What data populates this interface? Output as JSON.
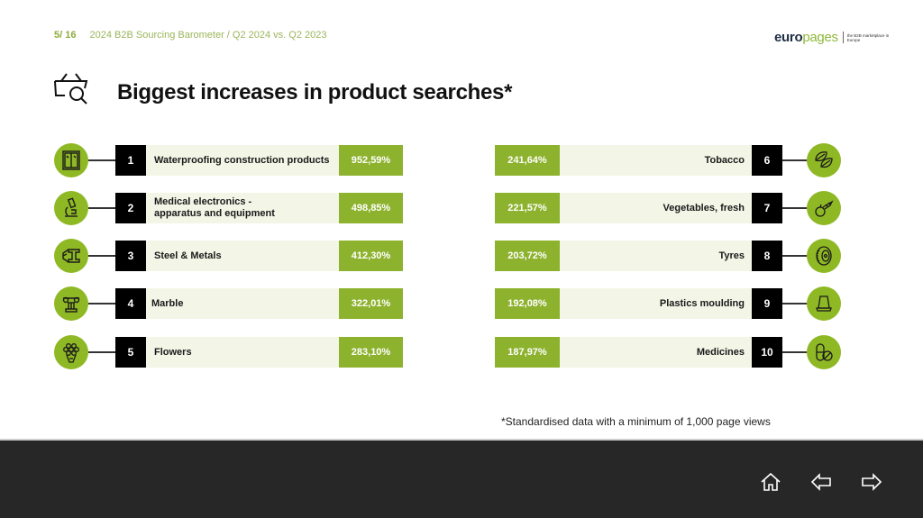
{
  "header": {
    "page_indicator": "5/ 16",
    "breadcrumb": "2024 B2B Sourcing Barometer / Q2 2024 vs. Q2 2023"
  },
  "logo": {
    "part1": "euro",
    "part2": "pages",
    "tagline": "the B2B marketplace in Europe"
  },
  "title": "Biggest increases in product searches*",
  "colors": {
    "accent_green": "#8db22e",
    "label_bg": "#f3f5e6",
    "number_bg": "#000000",
    "footer_bg": "#272727"
  },
  "left_items": [
    {
      "rank": "1",
      "label": "Waterproofing construction products",
      "value": "952,59%",
      "icon": "window-icon"
    },
    {
      "rank": "2",
      "label": "Medical electronics - apparatus and equipment",
      "label_line1": "Medical electronics -",
      "label_line2": "apparatus and equipment",
      "value": "498,85%",
      "icon": "microscope-icon"
    },
    {
      "rank": "3",
      "label": "Steel & Metals",
      "value": "412,30%",
      "icon": "steel-beam-icon"
    },
    {
      "rank": "4",
      "label": "Marble",
      "value": "322,01%",
      "icon": "column-icon"
    },
    {
      "rank": "5",
      "label": "Flowers",
      "value": "283,10%",
      "icon": "bouquet-icon"
    }
  ],
  "right_items": [
    {
      "rank": "6",
      "label": "Tobacco",
      "value": "241,64%",
      "icon": "leaves-icon"
    },
    {
      "rank": "7",
      "label": "Vegetables, fresh",
      "value": "221,57%",
      "icon": "vegetables-icon"
    },
    {
      "rank": "8",
      "label": "Tyres",
      "value": "203,72%",
      "icon": "tyre-icon"
    },
    {
      "rank": "9",
      "label": "Plastics moulding",
      "value": "192,08%",
      "icon": "moulded-cup-icon"
    },
    {
      "rank": "10",
      "label": "Medicines",
      "value": "187,97%",
      "icon": "pills-icon"
    }
  ],
  "footnote": "*Standardised data with a minimum of 1,000 page views",
  "navigation": {
    "home": "home-icon",
    "previous": "arrow-left-icon",
    "next": "arrow-right-icon"
  }
}
